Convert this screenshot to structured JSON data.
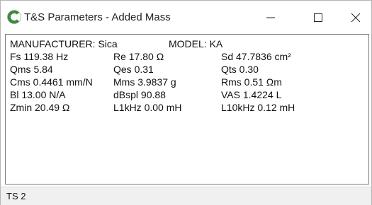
{
  "window": {
    "title": "T&S Parameters - Added Mass",
    "icon": "c-logo-icon",
    "brand_color": "#3d8b3d"
  },
  "controls": {
    "minimize_icon": "minimize-icon",
    "maximize_icon": "maximize-icon",
    "close_icon": "close-icon"
  },
  "header": {
    "manufacturer": "MANUFACTURER: Sica",
    "model": "MODEL: KA"
  },
  "params": [
    [
      "Fs 119.38 Hz",
      "Re 17.80 Ω",
      "Sd 47.7836 cm²"
    ],
    [
      "Qms 5.84",
      "Qes 0.31",
      "Qts 0.30"
    ],
    [
      "Cms 0.4461 mm/N",
      "Mms 3.9837 g",
      "Rms 0.51 Ωm"
    ],
    [
      "Bl 13.00 N/A",
      "dBspl 90.88",
      "VAS 1.4224 L"
    ],
    [
      "Zmin 20.49 Ω",
      "L1kHz 0.00 mH",
      "L10kHz 0.12 mH"
    ]
  ],
  "status": {
    "text": "TS 2"
  }
}
